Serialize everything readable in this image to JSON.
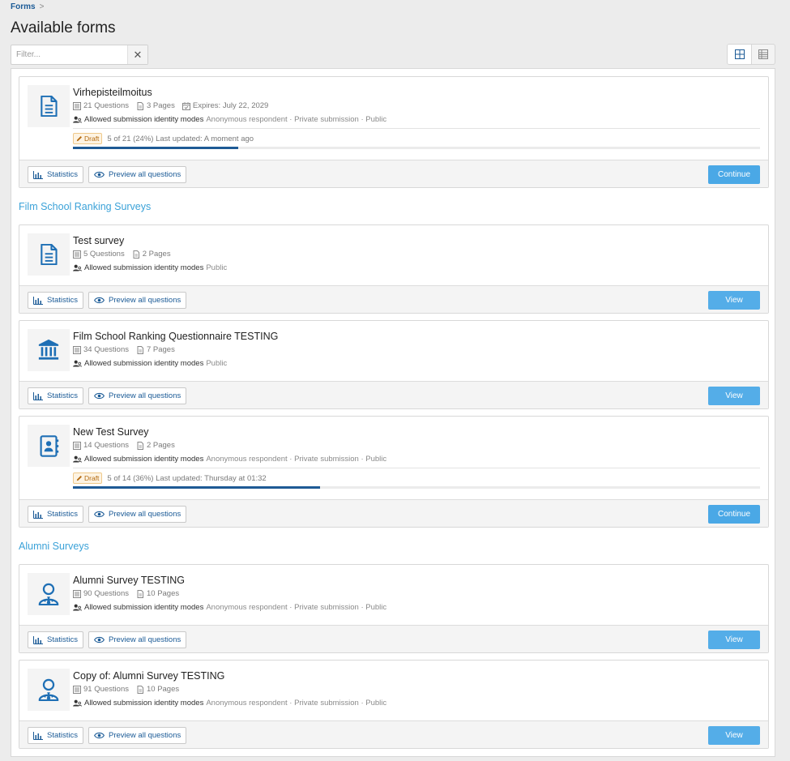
{
  "breadcrumb": {
    "root": "Forms",
    "separator": ">"
  },
  "page": {
    "title": "Available forms"
  },
  "filter": {
    "placeholder": "Filter...",
    "clear_label": "✕"
  },
  "sections": [
    {
      "title": "Film School Ranking Surveys"
    },
    {
      "title": "Alumni Surveys"
    }
  ],
  "labels": {
    "statistics": "Statistics",
    "preview": "Preview all questions",
    "allowed_modes": "Allowed submission identity modes"
  },
  "forms": [
    {
      "title": "Virhepisteilmoitus",
      "icon": "document-icon",
      "questions": "21 Questions",
      "pages": "3 Pages",
      "expires": "Expires: July 22, 2029",
      "modes": "Anonymous respondent · Private submission · Public",
      "draft": {
        "badge": "Draft",
        "status": "5 of 21 (24%) Last updated: A moment ago",
        "progress": 0.24
      },
      "action": "Continue"
    },
    {
      "title": "Test survey",
      "icon": "document-icon",
      "questions": "5 Questions",
      "pages": "2 Pages",
      "modes": "Public",
      "action": "View"
    },
    {
      "title": "Film School Ranking Questionnaire TESTING",
      "icon": "institution-icon",
      "questions": "34 Questions",
      "pages": "7 Pages",
      "modes": "Public",
      "action": "View"
    },
    {
      "title": "New Test Survey",
      "icon": "contact-book-icon",
      "questions": "14 Questions",
      "pages": "2 Pages",
      "modes": "Anonymous respondent · Private submission · Public",
      "draft": {
        "badge": "Draft",
        "status": "5 of 14 (36%) Last updated: Thursday at 01:32",
        "progress": 0.36
      },
      "action": "Continue"
    },
    {
      "title": "Alumni Survey TESTING",
      "icon": "user-tie-icon",
      "questions": "90 Questions",
      "pages": "10 Pages",
      "modes": "Anonymous respondent · Private submission · Public",
      "action": "View"
    },
    {
      "title": "Copy of: Alumni Survey TESTING",
      "icon": "user-tie-icon",
      "questions": "91 Questions",
      "pages": "10 Pages",
      "modes": "Anonymous respondent · Private submission · Public",
      "action": "View"
    }
  ]
}
